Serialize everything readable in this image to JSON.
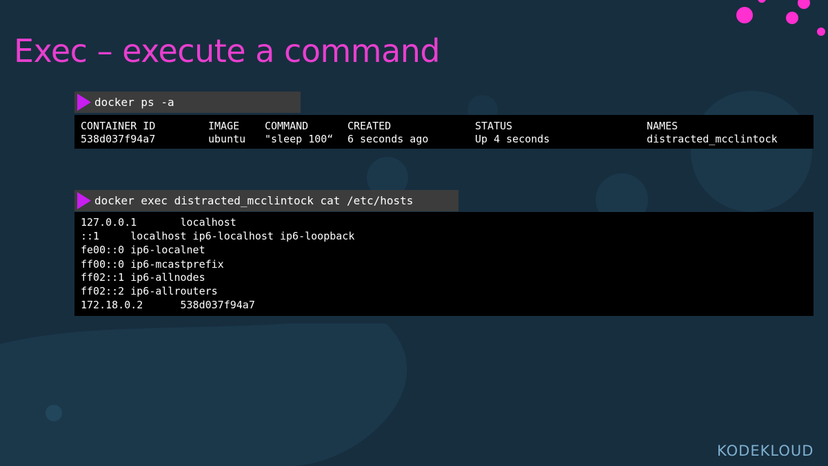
{
  "slide": {
    "title": "Exec – execute a command",
    "colors": {
      "background": "#172e3f",
      "title": "#e83fcf",
      "prompt_arrow": "#c81ef0",
      "terminal": "#000000",
      "command_bar": "#3c3c3c",
      "decor_circles": "#ff2fd0"
    }
  },
  "ps_command": {
    "prompt_icon": "play-triangle-icon",
    "command": "docker ps -a",
    "headers": [
      "CONTAINER ID",
      "IMAGE",
      "COMMAND",
      "CREATED",
      "STATUS",
      "NAMES"
    ],
    "rows": [
      [
        "538d037f94a7",
        "ubuntu",
        "\"sleep 100“",
        "6 seconds ago",
        "Up 4 seconds",
        "distracted_mcclintock"
      ]
    ]
  },
  "exec_command": {
    "prompt_icon": "play-triangle-icon",
    "command": "docker exec distracted_mcclintock cat /etc/hosts",
    "output_lines": [
      "127.0.0.1       localhost",
      "::1     localhost ip6-localhost ip6-loopback",
      "fe00::0 ip6-localnet",
      "ff00::0 ip6-mcastprefix",
      "ff02::1 ip6-allnodes",
      "ff02::2 ip6-allrouters",
      "172.18.0.2      538d037f94a7"
    ]
  },
  "logo": {
    "text": "KODEKLOUD"
  }
}
